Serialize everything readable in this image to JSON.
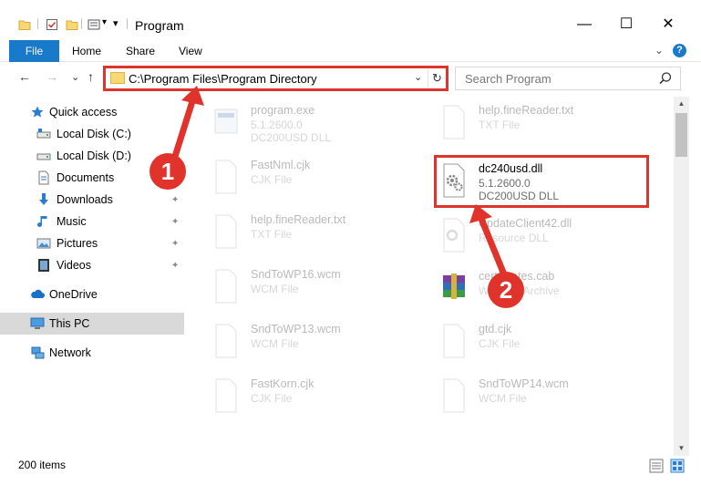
{
  "window": {
    "title": "Program",
    "minimize": "—",
    "maximize": "☐",
    "close": "✕"
  },
  "ribbon": {
    "tabs": [
      "File",
      "Home",
      "Share",
      "View"
    ],
    "collapse": "⌄",
    "help": "?"
  },
  "address": {
    "path": "C:\\Program Files\\Program Directory",
    "back": "←",
    "forward": "→",
    "recent": "⌄",
    "up": "↑",
    "dropdown": "⌄",
    "refresh": "↻"
  },
  "search": {
    "placeholder": "Search Program"
  },
  "sidebar": {
    "items": [
      {
        "label": "Quick access",
        "icon": "star-icon",
        "pinned": false
      },
      {
        "label": "Local Disk (C:)",
        "icon": "drive-icon",
        "pinned": false
      },
      {
        "label": "Local Disk (D:)",
        "icon": "drive-icon",
        "pinned": false
      },
      {
        "label": "Documents",
        "icon": "documents-icon",
        "pinned": true
      },
      {
        "label": "Downloads",
        "icon": "download-icon",
        "pinned": true
      },
      {
        "label": "Music",
        "icon": "music-icon",
        "pinned": true
      },
      {
        "label": "Pictures",
        "icon": "pictures-icon",
        "pinned": true
      },
      {
        "label": "Videos",
        "icon": "videos-icon",
        "pinned": true
      },
      {
        "label": "OneDrive",
        "icon": "cloud-icon",
        "pinned": false
      },
      {
        "label": "This PC",
        "icon": "computer-icon",
        "pinned": false,
        "selected": true
      },
      {
        "label": "Network",
        "icon": "network-icon",
        "pinned": false
      }
    ],
    "pin_glyph": "📌"
  },
  "files": {
    "left": [
      {
        "name": "program.exe",
        "line1": "5.1.2600.0",
        "line2": "DC200USD DLL",
        "icon": "exe-icon"
      },
      {
        "name": "FastNml.cjk",
        "line1": "CJK File",
        "line2": "",
        "icon": "file-icon"
      },
      {
        "name": "help.fineReader.txt",
        "line1": "TXT File",
        "line2": "",
        "icon": "file-icon"
      },
      {
        "name": "SndToWP16.wcm",
        "line1": "WCM File",
        "line2": "",
        "icon": "file-icon"
      },
      {
        "name": "SndToWP13.wcm",
        "line1": "WCM File",
        "line2": "",
        "icon": "file-icon"
      },
      {
        "name": "FastKorn.cjk",
        "line1": "CJK File",
        "line2": "",
        "icon": "file-icon"
      }
    ],
    "right": [
      {
        "name": "help.fineReader.txt",
        "line1": "TXT File",
        "line2": "",
        "icon": "file-icon",
        "faded": true
      },
      {
        "name": "dc240usd.dll",
        "line1": "5.1.2600.0",
        "line2": "DC200USD DLL",
        "icon": "dll-icon",
        "faded": false
      },
      {
        "name": "UpdateClient42.dll",
        "line1": "Resource DLL",
        "line2": "",
        "icon": "dll-icon",
        "faded": true
      },
      {
        "name": "certificates.cab",
        "line1": "WinRAR Archive",
        "line2": "",
        "icon": "archive-icon",
        "faded": true
      },
      {
        "name": "gtd.cjk",
        "line1": "CJK File",
        "line2": "",
        "icon": "file-icon",
        "faded": true
      },
      {
        "name": "SndToWP14.wcm",
        "line1": "WCM File",
        "line2": "",
        "icon": "file-icon",
        "faded": true
      }
    ]
  },
  "status": {
    "count": "200 items"
  },
  "annotations": {
    "step1": "1",
    "step2": "2"
  },
  "colors": {
    "accent": "#1979ca",
    "highlight": "#e0332b",
    "selected": "#d9d9d9"
  }
}
